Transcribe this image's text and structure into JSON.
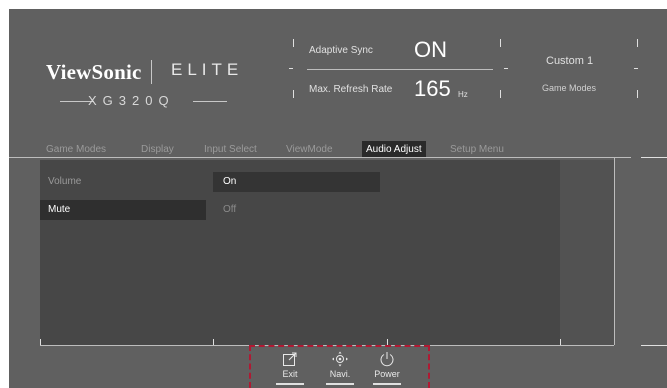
{
  "brand": {
    "logo": "ViewSonic",
    "line": "ELITE",
    "model": "XG320Q"
  },
  "header": {
    "adaptive_sync_label": "Adaptive Sync",
    "adaptive_sync_value": "ON",
    "refresh_label": "Max. Refresh Rate",
    "refresh_value": "165",
    "refresh_unit": "Hz",
    "profile_value": "Custom 1",
    "profile_label": "Game Modes"
  },
  "tabs": [
    {
      "label": "Game Modes",
      "active": false
    },
    {
      "label": "Display",
      "active": false
    },
    {
      "label": "Input Select",
      "active": false
    },
    {
      "label": "ViewMode",
      "active": false
    },
    {
      "label": "Audio Adjust",
      "active": true
    },
    {
      "label": "Setup Menu",
      "active": false
    }
  ],
  "menu": {
    "items": [
      {
        "label": "Volume",
        "selected": false
      },
      {
        "label": "Mute",
        "selected": true
      }
    ],
    "options": [
      {
        "label": "On",
        "selected": true
      },
      {
        "label": "Off",
        "selected": false
      }
    ]
  },
  "controls": [
    {
      "label": "Exit",
      "icon": "exit-icon"
    },
    {
      "label": "Navi.",
      "icon": "navi-joystick-icon"
    },
    {
      "label": "Power",
      "icon": "power-icon"
    }
  ],
  "colors": {
    "highlight_dash": "#b01933",
    "osd_background": "#606060"
  }
}
